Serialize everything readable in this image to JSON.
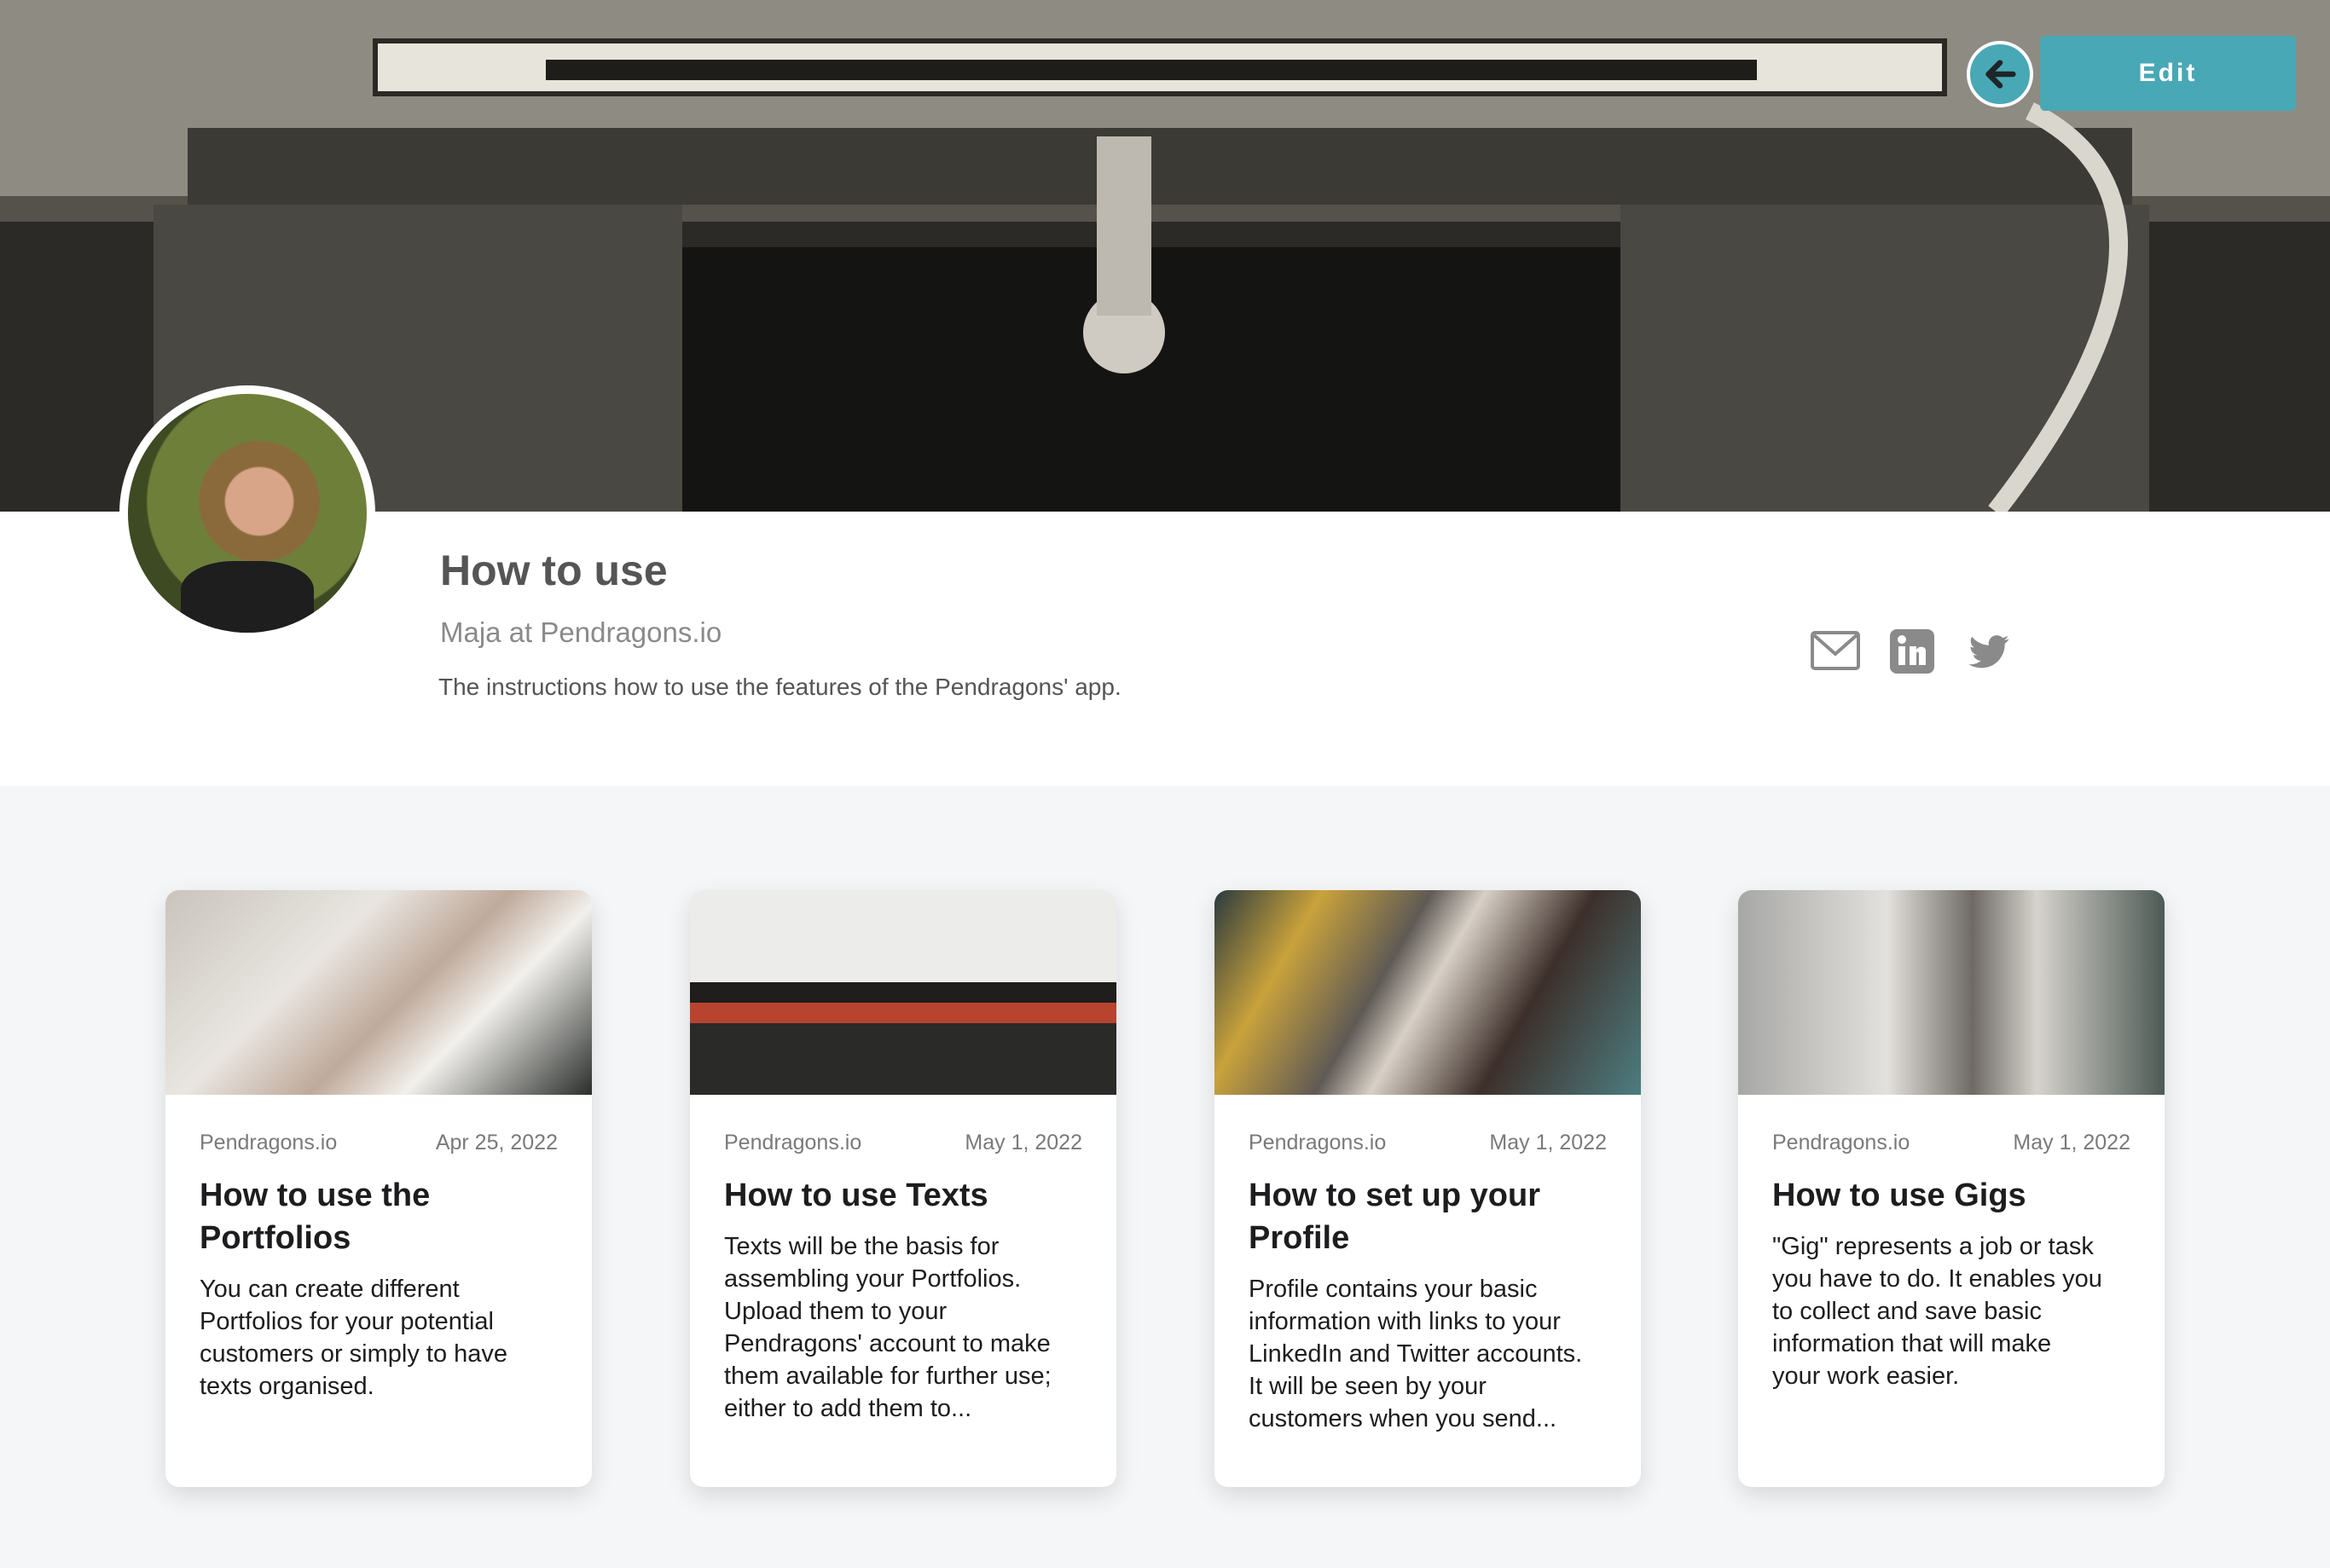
{
  "header": {
    "edit_label": "Edit",
    "back_icon": "arrow-left-icon"
  },
  "profile": {
    "title": "How to use",
    "subtitle": "Maja at Pendragons.io",
    "description": "The instructions how to use the features of the Pendragons' app.",
    "social": [
      "mail-icon",
      "linkedin-icon",
      "twitter-icon"
    ]
  },
  "colors": {
    "accent": "#49a8b5",
    "background": "#f5f6f7",
    "text": "#1d1d1f"
  },
  "cards": [
    {
      "source": "Pendragons.io",
      "date": "Apr 25, 2022",
      "title_line1": "How to use the",
      "title_line2": "Portfolios",
      "excerpt": [
        "You can create different",
        "Portfolios for your potential",
        "customers or simply to have",
        "texts organised."
      ]
    },
    {
      "source": "Pendragons.io",
      "date": "May 1, 2022",
      "title_line1": "How to use Texts",
      "title_line2": "",
      "excerpt": [
        "Texts will be the basis for",
        "assembling your Portfolios.",
        "Upload them to your",
        "Pendragons' account to make",
        "them available for further use;",
        "either to add them to..."
      ]
    },
    {
      "source": "Pendragons.io",
      "date": "May 1, 2022",
      "title_line1": "How to set up your",
      "title_line2": "Profile",
      "excerpt": [
        "Profile contains your basic",
        "information with links to your",
        "LinkedIn and Twitter accounts.",
        "It will be seen by your",
        "customers when you send..."
      ]
    },
    {
      "source": "Pendragons.io",
      "date": "May 1, 2022",
      "title_line1": "How to use Gigs",
      "title_line2": "",
      "excerpt": [
        "\"Gig\" represents a job or task",
        "you have to do. It enables you",
        "to collect and save basic",
        "information that will make",
        "your work easier."
      ]
    }
  ]
}
